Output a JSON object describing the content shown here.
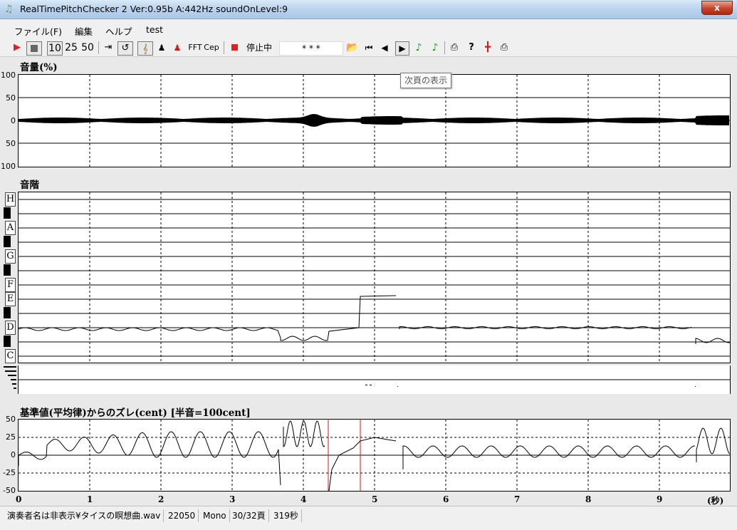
{
  "window": {
    "title": "RealTimePitchChecker 2    Ver:0.95b          A:442Hz     soundOnLevel:9",
    "close_label": "x"
  },
  "menu": [
    "ファイル(F)",
    "編集",
    "ヘルプ",
    "test"
  ],
  "toolbar": {
    "num10": "10",
    "num25": "25",
    "num50": "50",
    "fft": "FFT",
    "cep": "Cep",
    "status": "停止中",
    "stars": "* * *"
  },
  "tooltip": "次頁の表示",
  "panels": {
    "volume": {
      "title": "音量(%)",
      "yticks": [
        "100",
        "50",
        "0",
        "50",
        "100"
      ]
    },
    "scale": {
      "title": "音階",
      "notes": [
        "H",
        "A",
        "G",
        "F",
        "E",
        "D",
        "C"
      ]
    },
    "deviation": {
      "title": "基準値(平均律)からのズレ(cent) [半音=100cent]",
      "yticks": [
        "50",
        "25",
        "0",
        "-25",
        "-50"
      ]
    }
  },
  "xaxis": {
    "ticks": [
      "0",
      "1",
      "2",
      "3",
      "4",
      "5",
      "6",
      "7",
      "8",
      "9"
    ],
    "unit": "(秒)"
  },
  "statusbar": [
    "演奏者名は非表示¥タイスの瞑想曲.wav",
    "22050",
    "Mono",
    "30/32頁",
    "319秒"
  ],
  "colors": {
    "play": "#e02020",
    "marker": "#d01818",
    "green_note": "#1a9a1a"
  }
}
